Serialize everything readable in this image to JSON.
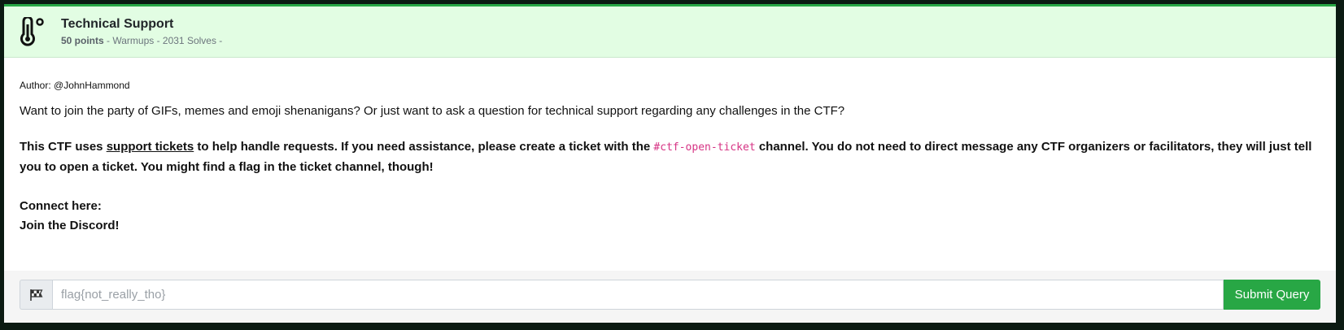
{
  "challenge": {
    "category_icon": "thermometer-icon",
    "title": "Technical Support",
    "points": "50 points",
    "meta_rest": " - Warmups - 2031 Solves -"
  },
  "description": {
    "author": "Author: @JohnHammond",
    "intro": "Want to join the party of GIFs, memes and emoji shenanigans? Or just want to ask a question for technical support regarding any challenges in the CTF?",
    "support_pre": "This CTF uses ",
    "support_link": "support tickets",
    "support_mid": " to help handle requests. If you need assistance, please create a ticket with the ",
    "channel": "#ctf-open-ticket",
    "support_post": " channel. You do not need to direct message any CTF organizers or facilitators, they will just tell you to open a ticket. You might find a flag in the ticket channel, though!",
    "connect_label": "Connect here:",
    "discord_link": "Join the Discord!"
  },
  "submission": {
    "flag_icon": "checkered-flag-icon",
    "placeholder": "flag{not_really_tho}",
    "submit_label": "Submit Query"
  },
  "colors": {
    "accent": "#28a745",
    "header_bg": "#e2fde3",
    "code": "#d63384"
  }
}
